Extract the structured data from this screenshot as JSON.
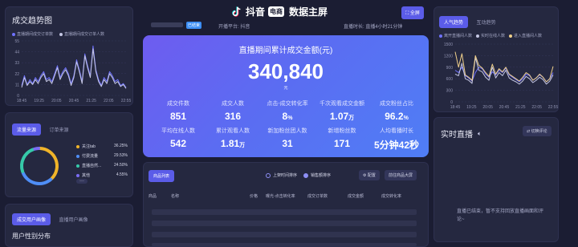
{
  "header": {
    "brand": "抖音",
    "badge": "电商",
    "screen_title": "数据主屏",
    "fullscreen_label": "全屏",
    "live_tag": "已结束",
    "platform": "开播平台: 抖音",
    "duration": "直播时长: 直播4小时21分钟"
  },
  "left_top": {
    "title": "成交趋势图",
    "legend": [
      {
        "name": "直播期间成交订单数",
        "color": "#6f72ff"
      },
      {
        "name": "直播期间成交订单人数",
        "color": "#c5c7e4"
      }
    ],
    "chart_data": {
      "type": "line",
      "x": [
        "18:45",
        "19:25",
        "20:05",
        "20:45",
        "21:25",
        "22:05",
        "22:55"
      ],
      "y_ticks": [
        0,
        11,
        22,
        33,
        44,
        55
      ],
      "ylim": [
        0,
        55
      ],
      "series": [
        {
          "name": "直播期间成交订单数",
          "color": "#6f72ff",
          "values": [
            10,
            20,
            11,
            16,
            12,
            18,
            14,
            20,
            24,
            16,
            18,
            14,
            22,
            30,
            18,
            24,
            28,
            22,
            12,
            20,
            36,
            26,
            14,
            42,
            30,
            20,
            50,
            26,
            16,
            10,
            18,
            14,
            24,
            20,
            14,
            16,
            10,
            12,
            8
          ]
        },
        {
          "name": "直播期间成交订单人数",
          "color": "#c5c7e4",
          "values": [
            8,
            18,
            10,
            14,
            11,
            16,
            12,
            18,
            22,
            14,
            16,
            12,
            20,
            28,
            16,
            22,
            26,
            20,
            10,
            18,
            34,
            24,
            12,
            40,
            28,
            18,
            47,
            24,
            14,
            9,
            16,
            12,
            22,
            18,
            12,
            14,
            9,
            11,
            7
          ]
        }
      ]
    }
  },
  "left_mid": {
    "tabs": [
      "流量来源",
      "订单来源"
    ],
    "active_tab": 0,
    "chart_data": {
      "type": "pie",
      "labels": [
        "关注tab",
        "付费流量",
        "直播自然...",
        "其他"
      ],
      "values": [
        36.25,
        29.53,
        24.5,
        4.55
      ],
      "display": [
        "36.25%",
        "29.53%",
        "24.50%",
        "4.55%"
      ],
      "colors": [
        "#f0b429",
        "#4f8ef7",
        "#36c9a9",
        "#7b6cf5"
      ]
    },
    "more_label": "···"
  },
  "left_bottom": {
    "tabs": [
      "成交用户画像",
      "直播用户画像"
    ],
    "active_tab": 0,
    "section_title": "用户性别分布"
  },
  "hero": {
    "title": "直播期间累计成交金额(元)",
    "value": "340,840",
    "unit": "元",
    "metrics": [
      {
        "label": "成交件数",
        "value": "851",
        "suffix": ""
      },
      {
        "label": "成交人数",
        "value": "316",
        "suffix": ""
      },
      {
        "label": "点击-成交转化率",
        "value": "8",
        "suffix": "%"
      },
      {
        "label": "千次观看成交金额",
        "value": "1.07",
        "suffix": "万"
      },
      {
        "label": "成交粉丝占比",
        "value": "96.2",
        "suffix": "%"
      },
      {
        "label": "平均在线人数",
        "value": "542",
        "suffix": ""
      },
      {
        "label": "累计观看人数",
        "value": "1.81",
        "suffix": "万"
      },
      {
        "label": "新加粉丝团人数",
        "value": "31",
        "suffix": ""
      },
      {
        "label": "新增粉丝数",
        "value": "171",
        "suffix": ""
      },
      {
        "label": "人均看播时长",
        "value": "5分钟42秒",
        "suffix": ""
      }
    ]
  },
  "product_list": {
    "tab_label": "商品列表",
    "sort_options": [
      "上架时间排序",
      "销售额排序"
    ],
    "active_sort": 1,
    "config_label": "配置",
    "goto_label": "前往商品大屏",
    "columns": [
      "商品",
      "名称",
      "价格",
      "曝光-点击转化率",
      "成交订单数",
      "成交金额",
      "成交转化率"
    ]
  },
  "right_top": {
    "tabs": [
      "人气趋势",
      "互动趋势"
    ],
    "active_tab": 0,
    "legend": [
      {
        "name": "离开直播间人数",
        "color": "#6f72ff"
      },
      {
        "name": "实时在线人数",
        "color": "#c5c7e4"
      },
      {
        "name": "进入直播间人数",
        "color": "#f0d08a"
      }
    ],
    "chart_data": {
      "type": "line",
      "x": [
        "18:45",
        "19:25",
        "20:05",
        "20:45",
        "21:25",
        "22:05",
        "22:55"
      ],
      "y_ticks": [
        0,
        300,
        600,
        900,
        1200,
        1500
      ],
      "ylim": [
        0,
        1500
      ],
      "series": [
        {
          "name": "离开直播间人数",
          "color": "#6f72ff",
          "values": [
            820,
            760,
            900,
            680,
            620,
            540,
            760,
            900,
            860,
            720,
            640,
            780,
            700,
            820,
            760,
            880,
            700,
            640,
            580,
            520,
            600,
            720,
            680,
            560,
            620,
            700,
            640,
            520,
            600,
            760
          ]
        },
        {
          "name": "实时在线人数",
          "color": "#c5c7e4",
          "values": [
            720,
            680,
            1000,
            600,
            560,
            480,
            1150,
            820,
            780,
            640,
            560,
            900,
            620,
            760,
            680,
            820,
            620,
            560,
            520,
            460,
            540,
            660,
            600,
            500,
            560,
            640,
            580,
            460,
            540,
            700
          ]
        },
        {
          "name": "进入直播间人数",
          "color": "#f0d08a",
          "values": [
            1300,
            900,
            1250,
            700,
            640,
            560,
            1200,
            950,
            880,
            760,
            660,
            980,
            720,
            860,
            780,
            900,
            720,
            660,
            600,
            540,
            640,
            760,
            700,
            560,
            620,
            720,
            640,
            520,
            600,
            920
          ]
        }
      ]
    }
  },
  "right_bottom": {
    "title": "实时直播",
    "toggle_label": "切换评论",
    "message": "直播已结束，暂不支持回放直播画面和评论~"
  }
}
